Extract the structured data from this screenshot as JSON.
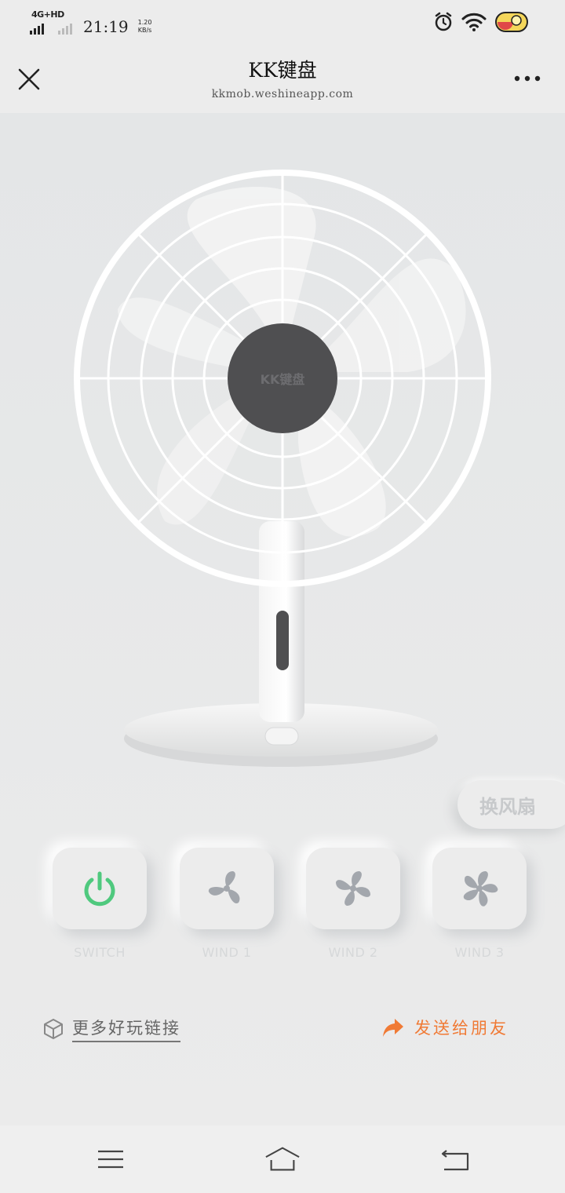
{
  "status_bar": {
    "network": "4G+HD",
    "time": "21:19",
    "speed_value": "1.20",
    "speed_unit": "KB/s"
  },
  "header": {
    "title": "KK键盘",
    "url": "kkmob.weshineapp.com"
  },
  "fan": {
    "hub_logo": "KK键盘"
  },
  "swap_fan_label": "换风扇",
  "controls": [
    {
      "label": "SWITCH",
      "icon": "power-icon"
    },
    {
      "label": "WIND 1",
      "icon": "fan-icon"
    },
    {
      "label": "WIND 2",
      "icon": "fan-icon"
    },
    {
      "label": "WIND 3",
      "icon": "fan-icon"
    }
  ],
  "links": {
    "more_links": "更多好玩链接",
    "share": "发送给朋友"
  },
  "colors": {
    "power_green": "#4fc97e",
    "share_orange": "#f07a35",
    "hub_dark": "#4f4f51"
  }
}
